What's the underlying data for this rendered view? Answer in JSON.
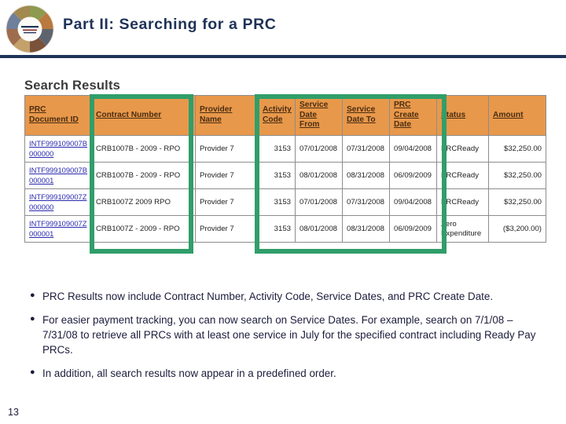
{
  "slide": {
    "title": "Part II: Searching for a PRC",
    "page_number": "13",
    "logo_name": "program-logo",
    "accent_navy": "#1f3258",
    "highlight_green": "#309e6a",
    "header_orange": "#e8984a"
  },
  "section": {
    "heading": "Search Results"
  },
  "table": {
    "columns": [
      {
        "key": "prc_document_id",
        "label": "PRC Document ID"
      },
      {
        "key": "contract_number",
        "label": "Contract Number"
      },
      {
        "key": "provider_name",
        "label": "Provider Name"
      },
      {
        "key": "activity_code",
        "label": "Activity Code"
      },
      {
        "key": "service_date_from",
        "label": "Service Date From"
      },
      {
        "key": "service_date_to",
        "label": "Service Date To"
      },
      {
        "key": "prc_create_date",
        "label": "PRC Create Date"
      },
      {
        "key": "status",
        "label": "Status"
      },
      {
        "key": "amount",
        "label": "Amount"
      }
    ],
    "rows": [
      {
        "prc_document_id": "INTF999109007B000000",
        "contract_number": "CRB1007B - 2009 - RPO",
        "provider_name": "Provider 7",
        "activity_code": "3153",
        "service_date_from": "07/01/2008",
        "service_date_to": "07/31/2008",
        "prc_create_date": "09/04/2008",
        "status": "PRCReady",
        "amount": "$32,250.00"
      },
      {
        "prc_document_id": "INTF999109007B000001",
        "contract_number": "CRB1007B - 2009 - RPO",
        "provider_name": "Provider 7",
        "activity_code": "3153",
        "service_date_from": "08/01/2008",
        "service_date_to": "08/31/2008",
        "prc_create_date": "06/09/2009",
        "status": "PRCReady",
        "amount": "$32,250.00"
      },
      {
        "prc_document_id": "INTF999109007Z000000",
        "contract_number": "CRB1007Z   2009   RPO",
        "provider_name": "Provider 7",
        "activity_code": "3153",
        "service_date_from": "07/01/2008",
        "service_date_to": "07/31/2008",
        "prc_create_date": "09/04/2008",
        "status": "PRCReady",
        "amount": "$32,250.00"
      },
      {
        "prc_document_id": "INTF999109007Z000001",
        "contract_number": "CRB1007Z - 2009 - RPO",
        "provider_name": "Provider 7",
        "activity_code": "3153",
        "service_date_from": "08/01/2008",
        "service_date_to": "08/31/2008",
        "prc_create_date": "06/09/2009",
        "status": "Zero Expenditure",
        "amount": "($3,200.00)"
      }
    ]
  },
  "highlights": [
    {
      "name": "contract-number-column",
      "label": "Contract Number column highlight"
    },
    {
      "name": "new-columns-group",
      "label": "Activity Code through PRC Create Date highlight"
    }
  ],
  "bullets": [
    "PRC Results now include Contract Number, Activity Code, Service Dates, and PRC Create Date.",
    "For easier payment tracking, you can now search on Service Dates.  For example, search on 7/1/08 – 7/31/08 to retrieve all PRCs with at least one service in July for the specified contract including Ready Pay PRCs.",
    "In addition, all search results now appear in a predefined order."
  ]
}
